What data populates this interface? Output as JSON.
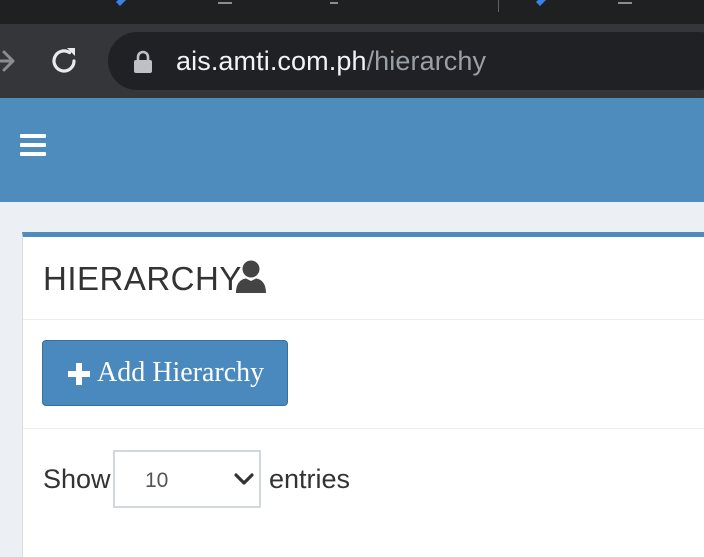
{
  "browser": {
    "url_host": "ais.amti.com.ph",
    "url_path": "/hierarchy"
  },
  "page": {
    "title": "HIERARCHY",
    "title_icon": "user-icon",
    "add_button_label": "Add Hierarchy",
    "add_button_icon": "plus-icon"
  },
  "table_controls": {
    "show_label": "Show",
    "page_size_value": "10",
    "entries_label": "entries"
  },
  "colors": {
    "header_blue": "#4d8cbc",
    "button_blue": "#4a89bd",
    "content_bg": "#ecf0f5"
  }
}
